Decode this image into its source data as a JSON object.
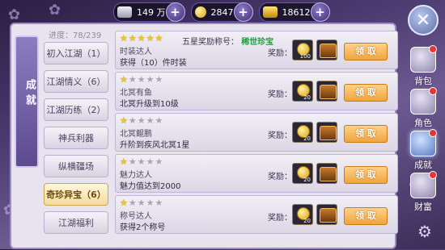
{
  "resources": [
    {
      "name": "silver",
      "value": "149 万",
      "color": "#c9c9d6"
    },
    {
      "name": "gold",
      "value": "2847",
      "color": "#f0c020"
    },
    {
      "name": "gold-bar",
      "value": "18612",
      "color": "#e8b400"
    }
  ],
  "panel": {
    "banner_title": "成就",
    "progress": "进度：78/239"
  },
  "categories": [
    "初入江湖（1）",
    "江湖情义（6）",
    "江湖历练（2）",
    "神兵利器",
    "纵横疆场",
    "奇珍异宝（6）",
    "江湖福利"
  ],
  "active_category": 5,
  "achievements": [
    {
      "stars": 5,
      "name": "时装达人",
      "desc": "获得（10）件时装",
      "title_note": "五星奖励称号：",
      "title_badge": "稀世珍宝",
      "reward_label": "奖励：",
      "coin_qty": "100",
      "claim": "领 取"
    },
    {
      "stars": 1,
      "name": "北冥有鱼",
      "desc": "北冥升级到10级",
      "reward_label": "奖励：",
      "coin_qty": "20",
      "claim": "领 取"
    },
    {
      "stars": 1,
      "name": "北冥鲲鹏",
      "desc": "升阶到疾风北冥1星",
      "reward_label": "奖励：",
      "coin_qty": "20",
      "claim": "领 取"
    },
    {
      "stars": 1,
      "name": "魅力达人",
      "desc": "魅力值达到2000",
      "reward_label": "奖励：",
      "coin_qty": "20",
      "claim": "领 取"
    },
    {
      "stars": 1,
      "name": "称号达人",
      "desc": "获得2个称号",
      "reward_label": "奖励：",
      "coin_qty": "20",
      "claim": "领 取"
    }
  ],
  "side_tabs": [
    {
      "label": "背包",
      "dot": true
    },
    {
      "label": "角色",
      "dot": true
    },
    {
      "label": "成就",
      "dot": true
    },
    {
      "label": "财富",
      "dot": true
    }
  ],
  "active_side_tab": 2
}
